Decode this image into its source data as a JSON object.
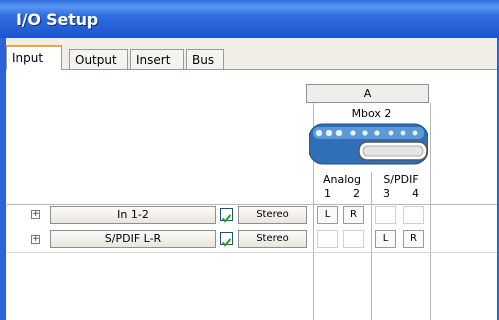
{
  "window": {
    "title": "I/O Setup"
  },
  "tabs": [
    {
      "label": "Input",
      "active": true
    },
    {
      "label": "Output",
      "active": false
    },
    {
      "label": "Insert",
      "active": false
    },
    {
      "label": "Bus",
      "active": false
    }
  ],
  "grid_header": {
    "group": "A",
    "device": "Mbox 2",
    "analog_label": "Analog",
    "spdif_label": "S/PDIF",
    "channel_numbers": [
      "1",
      "2",
      "3",
      "4"
    ]
  },
  "rows": [
    {
      "name": "In 1-2",
      "checked": true,
      "format": "Stereo",
      "assign": [
        "L",
        "R",
        "",
        ""
      ]
    },
    {
      "name": "S/PDIF L-R",
      "checked": true,
      "format": "Stereo",
      "assign": [
        "",
        "",
        "L",
        "R"
      ]
    }
  ],
  "colors": {
    "title_blue": "#2f6ee0",
    "active_tab_accent": "#f2a33a",
    "check_green": "#2f9a2f"
  }
}
